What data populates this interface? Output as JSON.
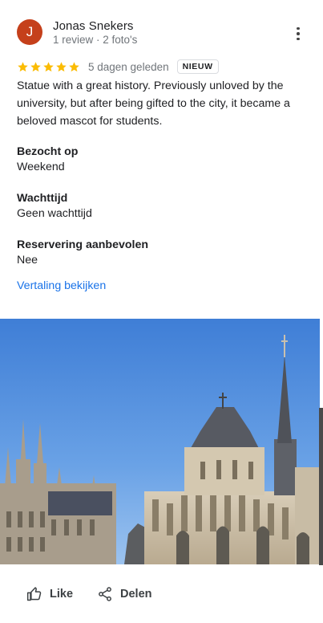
{
  "review": {
    "author": {
      "initial": "J",
      "name": "Jonas Snekers",
      "meta": "1 review · 2 foto's",
      "avatar_color": "#c5401b"
    },
    "rating": 5,
    "star_color": "#fbbc04",
    "date": "5 dagen geleden",
    "badge": "NIEUW",
    "text": "Statue with a great history. Previously unloved by the university, but after being gifted to the city, it became a beloved mascot for students.",
    "details": [
      {
        "label": "Bezocht op",
        "value": "Weekend"
      },
      {
        "label": "Wachttijd",
        "value": "Geen wachttijd"
      },
      {
        "label": "Reservering aanbevolen",
        "value": "Nee"
      }
    ],
    "translate_link": "Vertaling bekijken",
    "link_color": "#1a73e8"
  },
  "actions": {
    "like_label": "Like",
    "share_label": "Delen"
  },
  "icons": {
    "menu": "more-vert-icon",
    "star": "star-icon",
    "like": "thumb-up-icon",
    "share": "share-icon"
  }
}
